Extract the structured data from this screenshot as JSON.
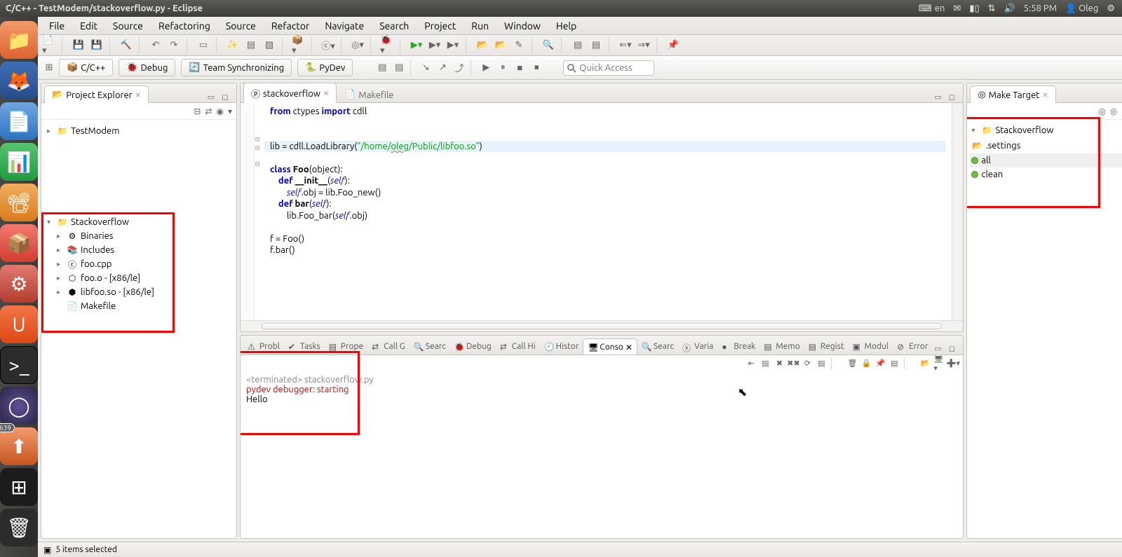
{
  "panel": {
    "title": "C/C++ - TestModem/stackoverflow.py - Eclipse",
    "lang": "en",
    "time": "5:58 PM",
    "user": "Oleg"
  },
  "launcher_badge": "639",
  "menu": [
    "File",
    "Edit",
    "Source",
    "Refactoring",
    "Source",
    "Refactor",
    "Navigate",
    "Search",
    "Project",
    "Run",
    "Window",
    "Help"
  ],
  "perspectives": [
    {
      "label": "C/C++",
      "icon": "📦",
      "active": true
    },
    {
      "label": "Debug",
      "icon": "🐞",
      "active": false
    },
    {
      "label": "Team Synchronizing",
      "icon": "🔄",
      "active": false
    },
    {
      "label": "PyDev",
      "icon": "🐍",
      "active": false
    }
  ],
  "quick_access_placeholder": "Quick Access",
  "project_explorer": {
    "title": "Project Explorer",
    "tree": {
      "p1": "TestModem",
      "p2": "Stackoverflow",
      "c1": "Binaries",
      "c2": "Includes",
      "c3": "foo.cpp",
      "c4": "foo.o - [x86/le]",
      "c5": "libfoo.so - [x86/le]",
      "c6": "Makefile"
    }
  },
  "editor": {
    "tabs": [
      {
        "label": "stackoverflow",
        "active": true
      },
      {
        "label": "Makefile",
        "active": false
      }
    ],
    "code": {
      "l1a": "from",
      "l1b": " ctypes ",
      "l1c": "import",
      "l1d": " cdll",
      "l4a": "lib = cdll.LoadLibrary(",
      "l4b": "\"/home/",
      "l4c": "oleg",
      "l4d": "/Public/libfoo.so\"",
      "l4e": ")",
      "l5a": "class",
      "l5b": " ",
      "l5c": "Foo",
      "l5d": "(object):",
      "l6a": "    ",
      "l6b": "def",
      "l6c": " ",
      "l6d": "__init__",
      "l6e": "(",
      "l6f": "self",
      "l6g": "):",
      "l7a": "        ",
      "l7b": "self",
      "l7c": ".obj = lib.Foo_new()",
      "l8a": "    ",
      "l8b": "def",
      "l8c": " ",
      "l8d": "bar",
      "l8e": "(",
      "l8f": "self",
      "l8g": "):",
      "l9a": "        lib.Foo_bar(",
      "l9b": "self",
      "l9c": ".obj)",
      "l11": "f = Foo()",
      "l12": "f.bar()"
    }
  },
  "bottom_tabs": [
    "Probl",
    "Tasks",
    "Prope",
    "Call G",
    "Searc",
    "Debug",
    "Call Hi",
    "Histor",
    "Conso",
    "Searc",
    "Varia",
    "Break",
    "Memo",
    "Regist",
    "Modul",
    "Error"
  ],
  "bottom_active": 8,
  "console": {
    "header": "<terminated> stackoverflow.py",
    "line1": "pydev debugger: starting",
    "line2": "Hello"
  },
  "make_target": {
    "title": "Make Target",
    "root": "Stackoverflow",
    "c1": ".settings",
    "t1": "all",
    "t2": "clean"
  },
  "status": "5 items selected"
}
